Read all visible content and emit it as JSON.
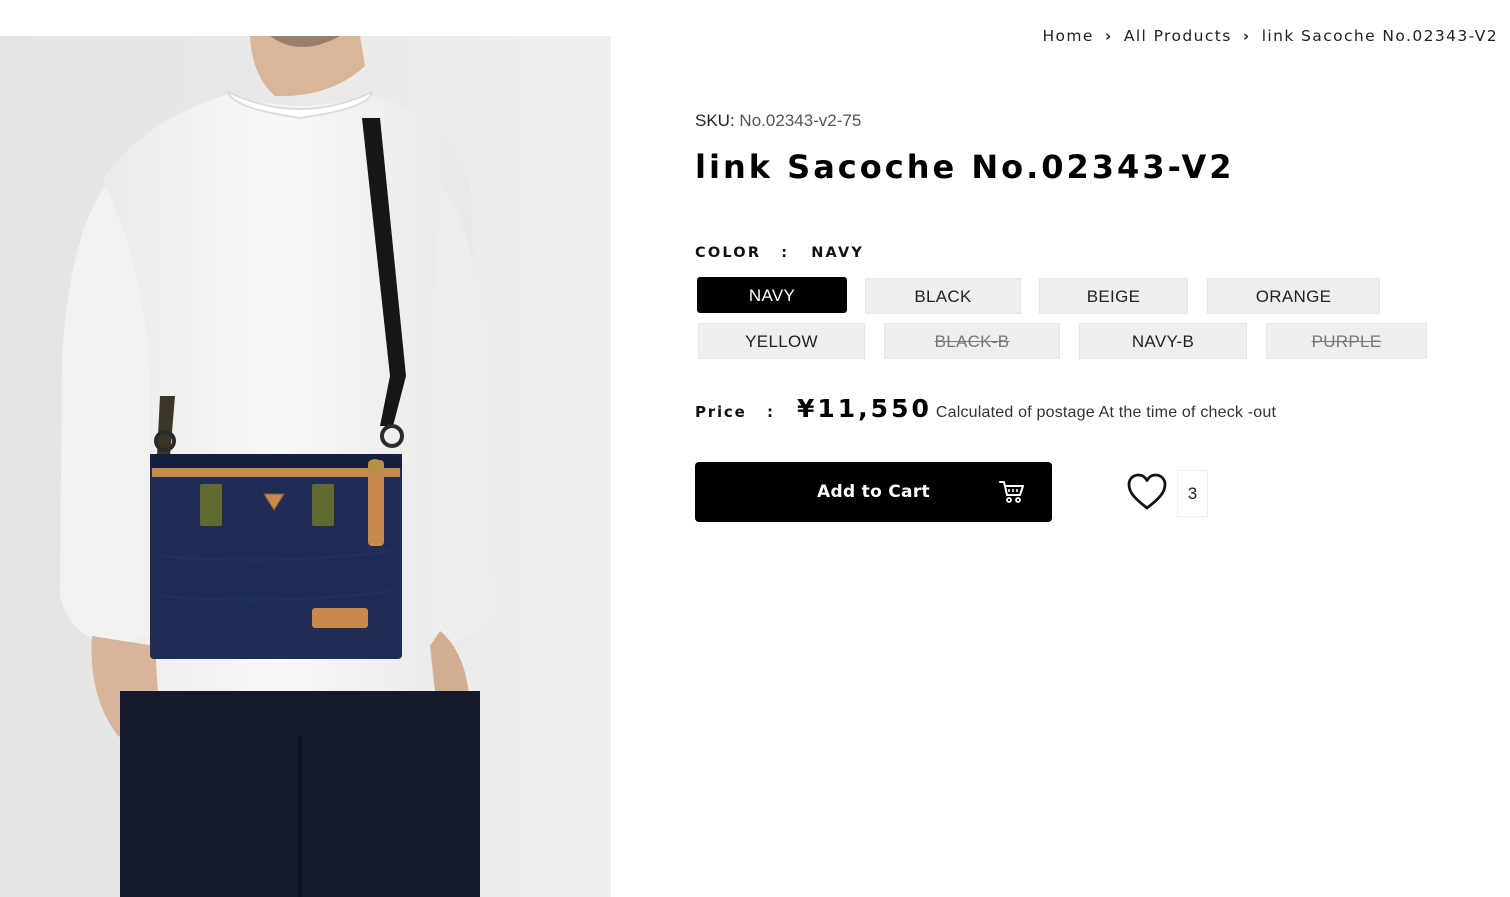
{
  "breadcrumb": {
    "home": "Home",
    "all_products": "All Products",
    "current": "link Sacoche No.02343-V2",
    "separator": "›"
  },
  "product": {
    "sku_label": "SKU:",
    "sku_value": "No.02343-v2-75",
    "title": "link Sacoche No.02343-V2",
    "image_alt": "Model wearing a navy cross-body sacoche bag with tan leather trim"
  },
  "color": {
    "label": "COLOR",
    "colon": ":",
    "selected": "NAVY",
    "options": [
      {
        "label": "NAVY",
        "state": "selected"
      },
      {
        "label": "BLACK",
        "state": "available"
      },
      {
        "label": "BEIGE",
        "state": "available"
      },
      {
        "label": "ORANGE",
        "state": "available"
      },
      {
        "label": "YELLOW",
        "state": "available"
      },
      {
        "label": "BLACK-B",
        "state": "sold-out"
      },
      {
        "label": "NAVY-B",
        "state": "available"
      },
      {
        "label": "PURPLE",
        "state": "sold-out"
      }
    ]
  },
  "price": {
    "label": "Price",
    "colon": ":",
    "value": "¥11,550",
    "note": "Calculated of postage At the time of check -out"
  },
  "cart": {
    "button_label": "Add to Cart",
    "icon": "cart-icon"
  },
  "wishlist": {
    "icon": "heart-icon",
    "count": "3"
  },
  "colors": {
    "primary": "#000000",
    "option_bg": "#efefef",
    "text": "#111111"
  }
}
